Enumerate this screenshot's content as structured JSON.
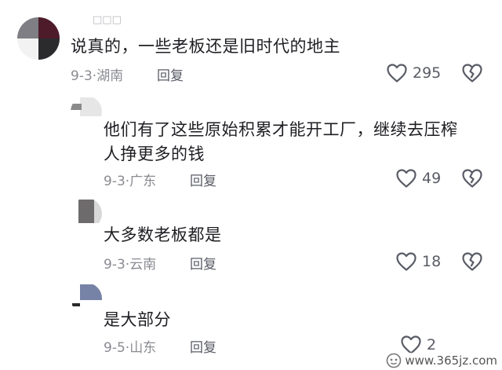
{
  "comments": [
    {
      "username": "□□□",
      "text_lines": [
        "说真的，一些老板还是旧时代的地主"
      ],
      "date": "9-3",
      "location": "湖南",
      "reply_label": "回复",
      "likes": "295"
    },
    {
      "username": "",
      "text_lines": [
        "他们有了这些原始积累才能开工厂，继续去压榨",
        "人挣更多的钱"
      ],
      "date": "9-3",
      "location": "广东",
      "reply_label": "回复",
      "likes": "49"
    },
    {
      "username": "",
      "text_lines": [
        "大多数老板都是"
      ],
      "date": "9-3",
      "location": "云南",
      "reply_label": "回复",
      "likes": "18"
    },
    {
      "username": "",
      "text_lines": [
        "是大部分"
      ],
      "date": "9-5",
      "location": "山东",
      "reply_label": "回复",
      "likes": "2"
    }
  ],
  "separator": "·",
  "watermark": {
    "text": "www.365jz.com"
  },
  "colors": {
    "text": "#1e1e23",
    "meta": "#8a8b91",
    "icon": "#5a5c66"
  }
}
